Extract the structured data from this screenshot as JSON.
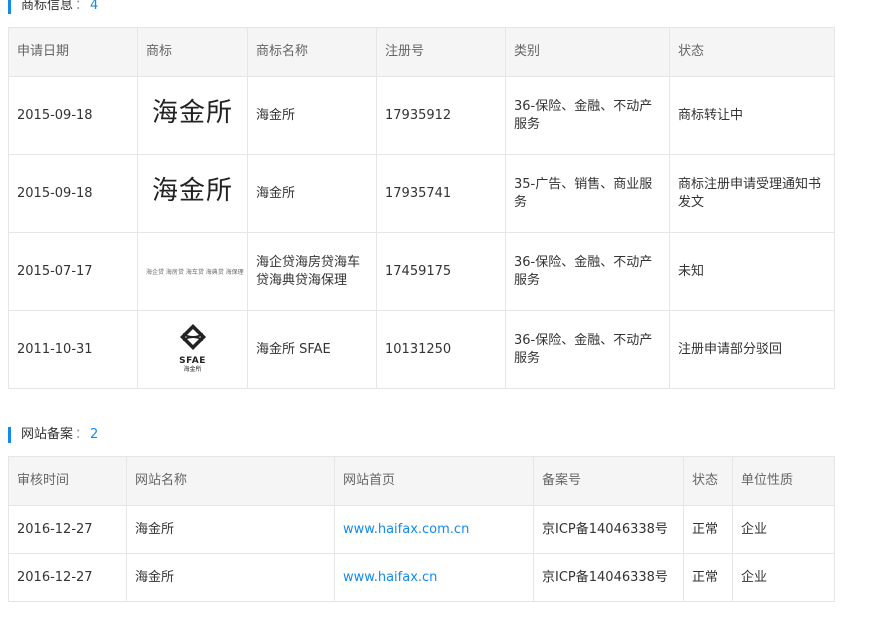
{
  "trademark": {
    "title": "商标信息",
    "sep": "：",
    "count": "4",
    "headers": [
      "申请日期",
      "商标",
      "商标名称",
      "注册号",
      "类别",
      "状态"
    ],
    "rows": [
      {
        "date": "2015-09-18",
        "logo_text": "海金所",
        "name": "海金所",
        "reg_no": "17935912",
        "category": "36-保险、金融、不动产服务",
        "status": "商标转让中"
      },
      {
        "date": "2015-09-18",
        "logo_text": "海金所",
        "name": "海金所",
        "reg_no": "17935741",
        "category": "35-广告、销售、商业服务",
        "status": "商标注册申请受理通知书发文"
      },
      {
        "date": "2015-07-17",
        "logo_text": "海企贷 海房贷 海车贷 海典贷 海保理",
        "name": "海企贷海房贷海车贷海典贷海保理",
        "reg_no": "17459175",
        "category": "36-保险、金融、不动产服务",
        "status": "未知"
      },
      {
        "date": "2011-10-31",
        "logo_text": "SFAE",
        "logo_subtext": "海金所",
        "name": "海金所 SFAE",
        "reg_no": "10131250",
        "category": "36-保险、金融、不动产服务",
        "status": "注册申请部分驳回"
      }
    ]
  },
  "website": {
    "title": "网站备案",
    "sep": "：",
    "count": "2",
    "headers": [
      "审核时间",
      "网站名称",
      "网站首页",
      "备案号",
      "状态",
      "单位性质"
    ],
    "rows": [
      {
        "date": "2016-12-27",
        "name": "海金所",
        "url": "www.haifax.com.cn",
        "icp": "京ICP备14046338号",
        "status": "正常",
        "type": "企业"
      },
      {
        "date": "2016-12-27",
        "name": "海金所",
        "url": "www.haifax.cn",
        "icp": "京ICP备14046338号",
        "status": "正常",
        "type": "企业"
      }
    ]
  },
  "colors": {
    "accent": "#128bed",
    "header_bg": "#f5f5f5",
    "border": "#e6e6e6"
  }
}
